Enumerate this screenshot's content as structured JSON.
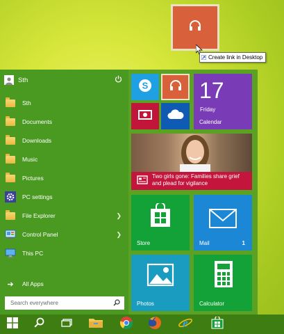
{
  "drag": {
    "tile_color": "#d8603a",
    "icon": "headphones-icon",
    "tooltip": "Create link in Desktop"
  },
  "start_menu": {
    "user_name": "Sth",
    "power_icon": "power-icon",
    "items": [
      {
        "label": "Sth",
        "icon": "user-folder-icon"
      },
      {
        "label": "Documents",
        "icon": "folder-icon"
      },
      {
        "label": "Downloads",
        "icon": "folder-icon"
      },
      {
        "label": "Music",
        "icon": "folder-icon"
      },
      {
        "label": "Pictures",
        "icon": "folder-icon"
      },
      {
        "label": "PC settings",
        "icon": "gear-icon"
      },
      {
        "label": "File Explorer",
        "icon": "folder-icon",
        "has_arrow": true
      },
      {
        "label": "Control Panel",
        "icon": "control-panel-icon",
        "has_arrow": true
      },
      {
        "label": "This PC",
        "icon": "computer-icon"
      }
    ],
    "all_apps": "All Apps",
    "search_placeholder": "Search everywhere"
  },
  "tiles": {
    "skype": {
      "icon": "skype-icon",
      "color": "#1fa0e3"
    },
    "music": {
      "icon": "headphones-icon",
      "color": "#d8603a"
    },
    "video": {
      "icon": "video-icon",
      "color": "#c1163a"
    },
    "onedrive": {
      "icon": "cloud-icon",
      "color": "#0f5bb3"
    },
    "calendar": {
      "day": "17",
      "weekday": "Friday",
      "label": "Calendar",
      "color": "#7a3bb6"
    },
    "news": {
      "headline": "Two girls gone: Families share grief and plead for vigilance",
      "color": "#c4163d"
    },
    "store": {
      "label": "Store",
      "color": "#13a237"
    },
    "mail": {
      "label": "Mail",
      "count": "1",
      "color": "#1c87d5"
    },
    "photos": {
      "label": "Photos",
      "color": "#1a9bc0"
    },
    "calculator": {
      "label": "Calculator",
      "color": "#13a237"
    }
  },
  "taskbar": {
    "items": [
      "windows-start-icon",
      "search-icon",
      "task-view-icon",
      "file-explorer-icon",
      "chrome-icon",
      "firefox-icon",
      "internet-explorer-icon",
      "store-icon"
    ]
  }
}
